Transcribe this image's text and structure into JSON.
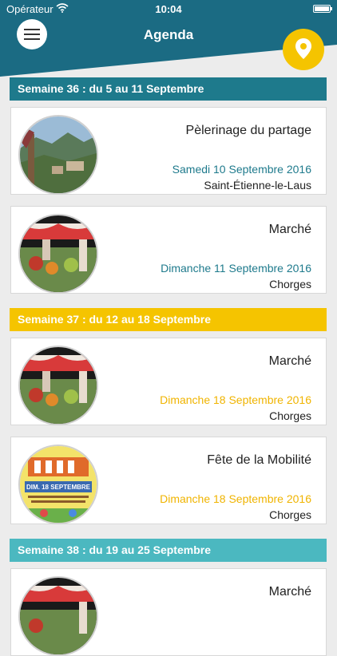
{
  "status": {
    "carrier": "Opérateur",
    "time": "10:04"
  },
  "header": {
    "title": "Agenda"
  },
  "colors": {
    "teal": "#1e7a8c",
    "yellow": "#f5c400",
    "light_teal": "#4bb8c0"
  },
  "weeks": [
    {
      "label": "Semaine 36 : du 5 au 11 Septembre",
      "color": "#1e7a8c",
      "events": [
        {
          "title": "Pèlerinage du partage",
          "date": "Samedi 10 Septembre 2016",
          "place": "Saint-Étienne-le-Laus",
          "image": "mountain-village"
        },
        {
          "title": "Marché",
          "date": "Dimanche 11 Septembre 2016",
          "place": "Chorges",
          "image": "market-stall"
        }
      ]
    },
    {
      "label": "Semaine 37 : du 12 au 18 Septembre",
      "color": "#f5c400",
      "events": [
        {
          "title": "Marché",
          "date": "Dimanche 18 Septembre 2016",
          "place": "Chorges",
          "image": "market-stall"
        },
        {
          "title": "Fête de la Mobilité",
          "date": "Dimanche 18 Septembre 2016",
          "place": "Chorges",
          "image": "festival-poster"
        }
      ]
    },
    {
      "label": "Semaine 38 : du 19 au 25 Septembre",
      "color": "#4bb8c0",
      "events": [
        {
          "title": "Marché",
          "image": "market-stall"
        }
      ]
    }
  ],
  "poster": {
    "date_text": "DIM. 18 SEPTEMBRE"
  }
}
